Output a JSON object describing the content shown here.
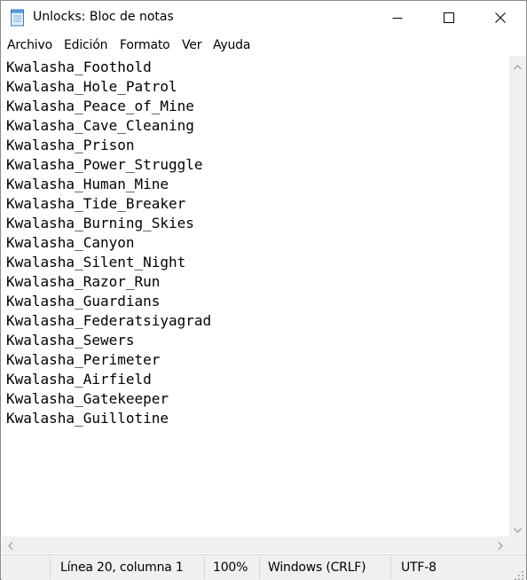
{
  "window": {
    "title": "Unlocks: Bloc de notas",
    "controls": [
      "minimize-icon",
      "maximize-icon",
      "close-icon"
    ]
  },
  "menu": {
    "items": [
      "Archivo",
      "Edición",
      "Formato",
      "Ver",
      "Ayuda"
    ]
  },
  "editor": {
    "lines": [
      "Kwalasha_Foothold",
      "Kwalasha_Hole_Patrol",
      "Kwalasha_Peace_of_Mine",
      "Kwalasha_Cave_Cleaning",
      "Kwalasha_Prison",
      "Kwalasha_Power_Struggle",
      "Kwalasha_Human_Mine",
      "Kwalasha_Tide_Breaker",
      "Kwalasha_Burning_Skies",
      "Kwalasha_Canyon",
      "Kwalasha_Silent_Night",
      "Kwalasha_Razor_Run",
      "Kwalasha_Guardians",
      "Kwalasha_Federatsiyagrad",
      "Kwalasha_Sewers",
      "Kwalasha_Perimeter",
      "Kwalasha_Airfield",
      "Kwalasha_Gatekeeper",
      "Kwalasha_Guillotine"
    ]
  },
  "status": {
    "position": "Línea 20, columna 1",
    "zoom": "100%",
    "line_ending": "Windows (CRLF)",
    "encoding": "UTF-8"
  },
  "colors": {
    "statusbar_bg": "#f0f0f0",
    "scrollbar_bg": "#f0f0f0",
    "text": "#000000"
  }
}
